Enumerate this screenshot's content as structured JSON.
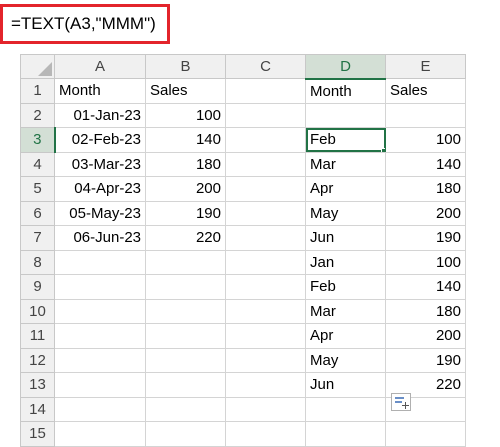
{
  "formula_bar": {
    "formula": "=TEXT(A3,\"MMM\")"
  },
  "columns": [
    "A",
    "B",
    "C",
    "D",
    "E"
  ],
  "active_column": "D",
  "active_row": "3",
  "rows": [
    {
      "num": "1",
      "A": "Month",
      "B": "Sales",
      "C": "",
      "D": "Month",
      "E": "Sales"
    },
    {
      "num": "2",
      "A": "01-Jan-23",
      "B": "100",
      "C": "",
      "D": "",
      "E": ""
    },
    {
      "num": "3",
      "A": "02-Feb-23",
      "B": "140",
      "C": "",
      "D": "Feb",
      "E": "100"
    },
    {
      "num": "4",
      "A": "03-Mar-23",
      "B": "180",
      "C": "",
      "D": "Mar",
      "E": "140"
    },
    {
      "num": "5",
      "A": "04-Apr-23",
      "B": "200",
      "C": "",
      "D": "Apr",
      "E": "180"
    },
    {
      "num": "6",
      "A": "05-May-23",
      "B": "190",
      "C": "",
      "D": "May",
      "E": "200"
    },
    {
      "num": "7",
      "A": "06-Jun-23",
      "B": "220",
      "C": "",
      "D": "Jun",
      "E": "190"
    },
    {
      "num": "8",
      "A": "",
      "B": "",
      "C": "",
      "D": "Jan",
      "E": "100"
    },
    {
      "num": "9",
      "A": "",
      "B": "",
      "C": "",
      "D": "Feb",
      "E": "140"
    },
    {
      "num": "10",
      "A": "",
      "B": "",
      "C": "",
      "D": "Mar",
      "E": "180"
    },
    {
      "num": "11",
      "A": "",
      "B": "",
      "C": "",
      "D": "Apr",
      "E": "200"
    },
    {
      "num": "12",
      "A": "",
      "B": "",
      "C": "",
      "D": "May",
      "E": "190"
    },
    {
      "num": "13",
      "A": "",
      "B": "",
      "C": "",
      "D": "Jun",
      "E": "220"
    },
    {
      "num": "14",
      "A": "",
      "B": "",
      "C": "",
      "D": "",
      "E": ""
    },
    {
      "num": "15",
      "A": "",
      "B": "",
      "C": "",
      "D": "",
      "E": ""
    }
  ],
  "icons": {
    "paste_options": "paste-options-icon",
    "select_all": "select-all-icon"
  },
  "colors": {
    "highlight_border": "#e3242b",
    "excel_green": "#217346"
  }
}
